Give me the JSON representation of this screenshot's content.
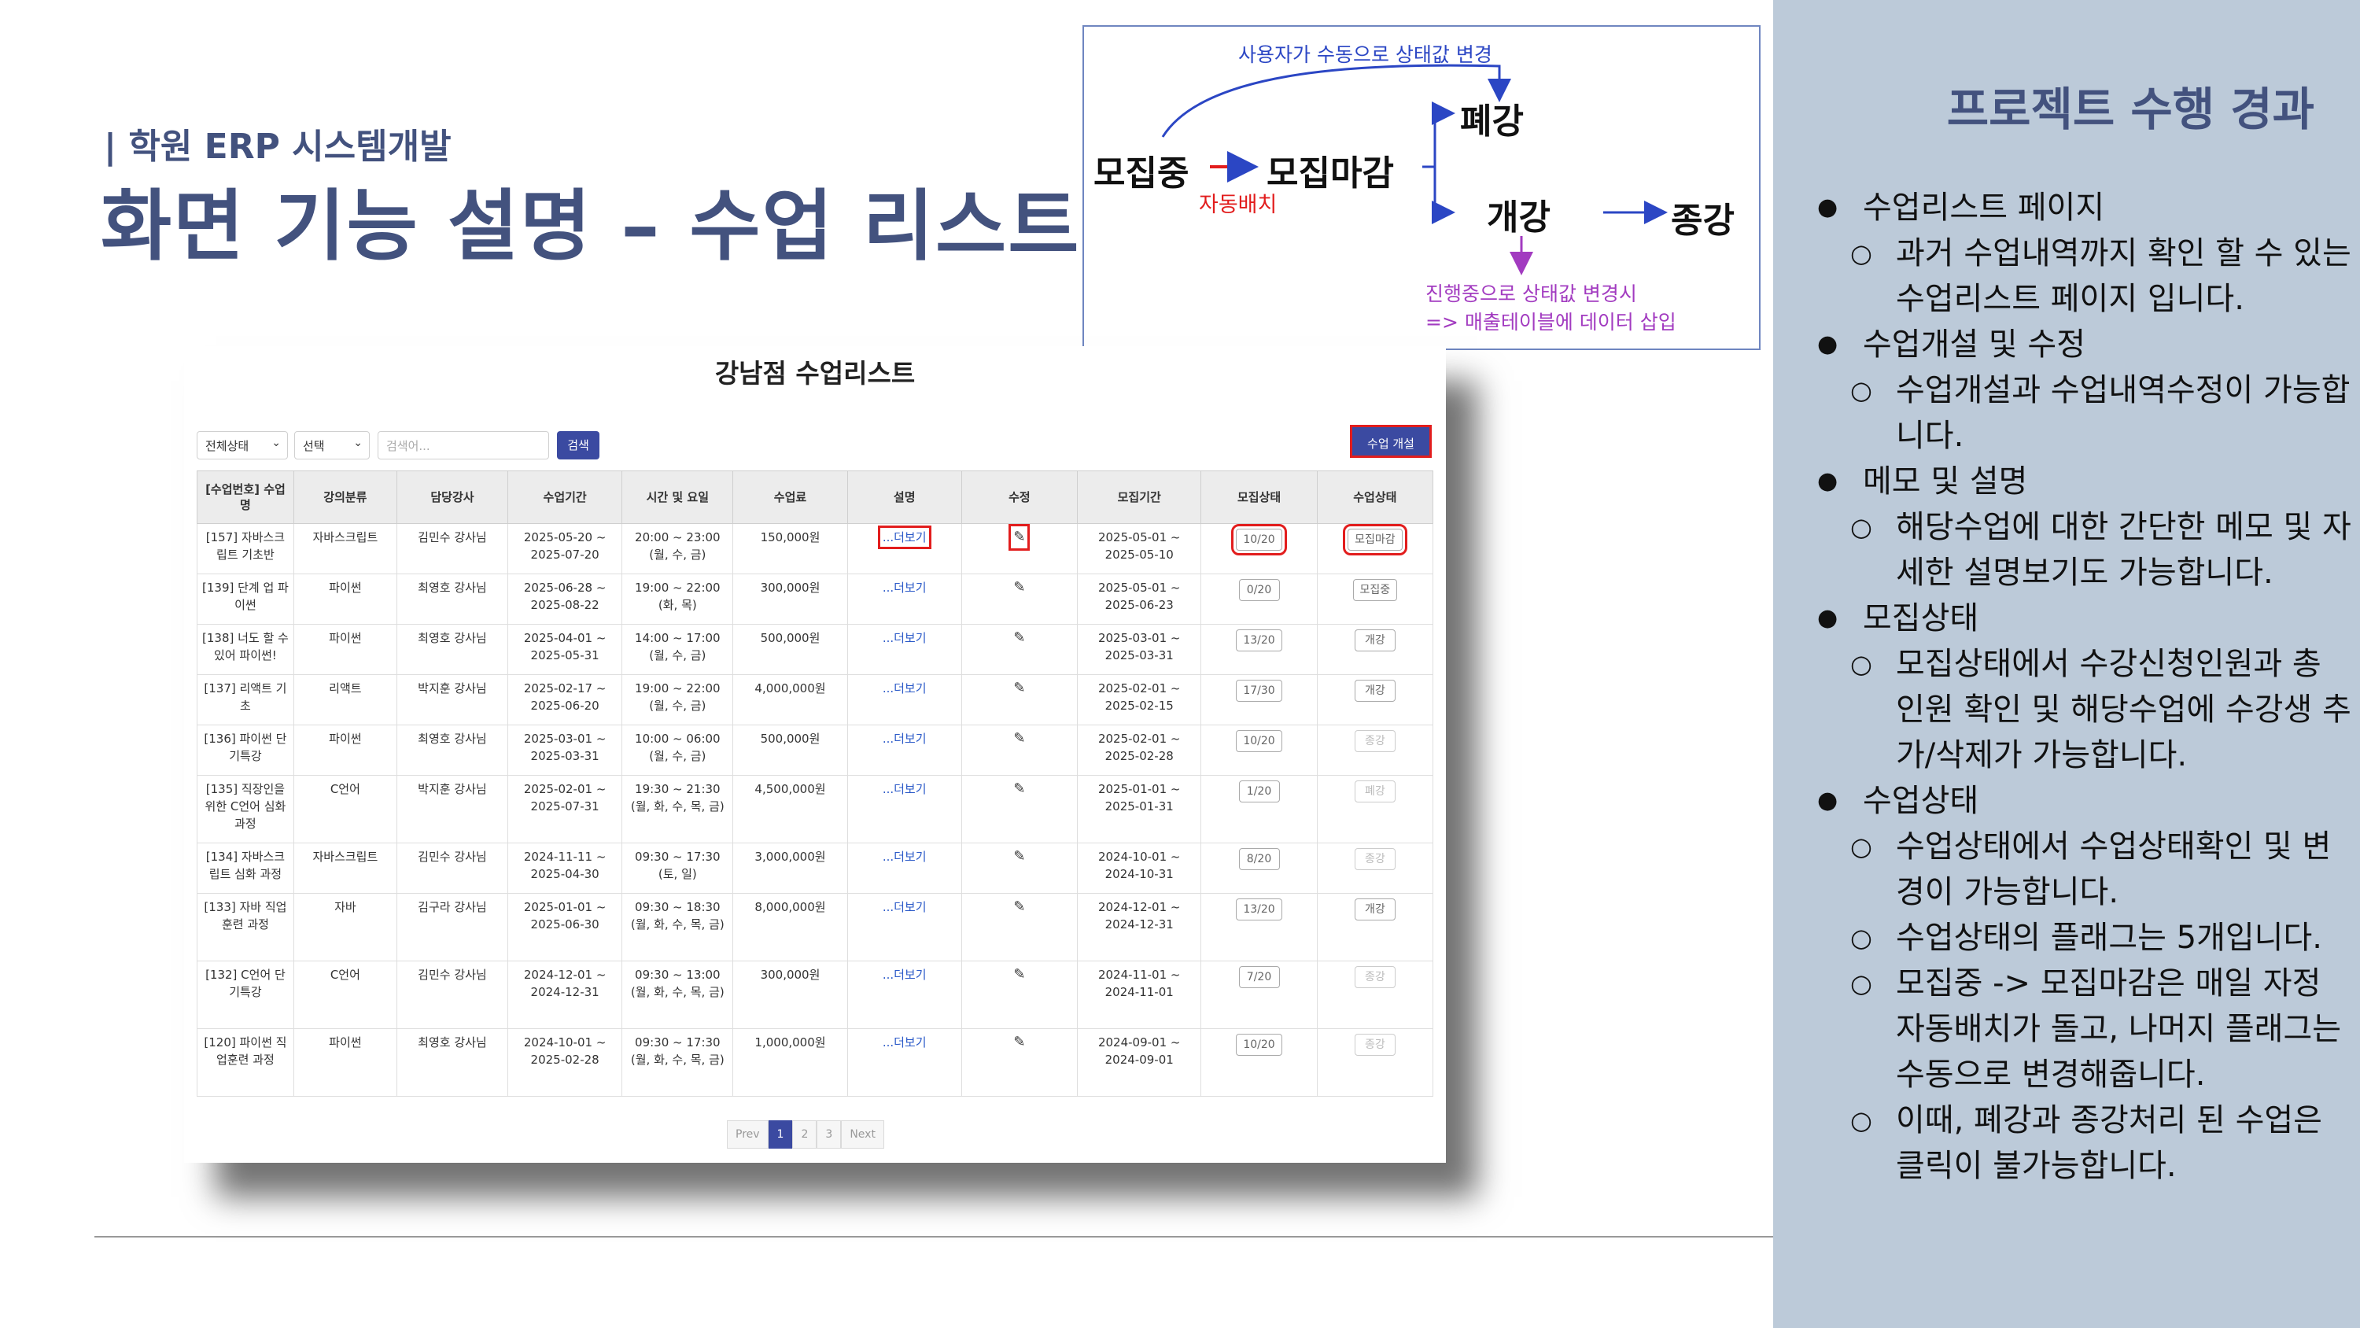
{
  "slide": {
    "subtitle": "| 학원 ERP 시스템개발",
    "title": "화면 기능 설명 – 수업 리스트"
  },
  "diagram": {
    "top_note": "사용자가 수동으로 상태값 변경",
    "node_recruiting": "모집중",
    "node_closed": "모집마감",
    "auto_label": "자동배치",
    "node_cancelled": "폐강",
    "node_opened": "개강",
    "node_ended": "종강",
    "bottom_note_1": "진행중으로 상태값 변경시",
    "bottom_note_2": "=> 매출테이블에 데이터 삽입"
  },
  "screenshot": {
    "title": "강남점 수업리스트",
    "filters": {
      "status": "전체상태",
      "select": "선택",
      "search_placeholder": "검색어...",
      "search_button": "검색",
      "open_button": "수업 개설"
    },
    "columns": [
      "[수업번호] 수업명",
      "강의분류",
      "담당강사",
      "수업기간",
      "시간 및 요일",
      "수업료",
      "설명",
      "수정",
      "모집기간",
      "모집상태",
      "수업상태"
    ],
    "rows": [
      {
        "name": "[157] 자바스크립트 기초반",
        "category": "자바스크립트",
        "teacher": "김민수 강사님",
        "period": "2025-05-20 ~ 2025-07-20",
        "time": "20:00 ~ 23:00 (월, 수, 금)",
        "fee": "150,000원",
        "desc": "...더보기",
        "edit": "✎",
        "recruit_period": "2025-05-01 ~ 2025-05-10",
        "recruit_status": "10/20",
        "class_status": "모집마감"
      },
      {
        "name": "[139] 단계 업 파이썬",
        "category": "파이썬",
        "teacher": "최영호 강사님",
        "period": "2025-06-28 ~ 2025-08-22",
        "time": "19:00 ~ 22:00 (화, 목)",
        "fee": "300,000원",
        "desc": "...더보기",
        "edit": "✎",
        "recruit_period": "2025-05-01 ~ 2025-06-23",
        "recruit_status": "0/20",
        "class_status": "모집중"
      },
      {
        "name": "[138] 너도 할 수 있어 파이썬!",
        "category": "파이썬",
        "teacher": "최영호 강사님",
        "period": "2025-04-01 ~ 2025-05-31",
        "time": "14:00 ~ 17:00 (월, 수, 금)",
        "fee": "500,000원",
        "desc": "...더보기",
        "edit": "✎",
        "recruit_period": "2025-03-01 ~ 2025-03-31",
        "recruit_status": "13/20",
        "class_status": "개강"
      },
      {
        "name": "[137] 리액트 기초",
        "category": "리액트",
        "teacher": "박지훈 강사님",
        "period": "2025-02-17 ~ 2025-06-20",
        "time": "19:00 ~ 22:00 (월, 수, 금)",
        "fee": "4,000,000원",
        "desc": "...더보기",
        "edit": "✎",
        "recruit_period": "2025-02-01 ~ 2025-02-15",
        "recruit_status": "17/30",
        "class_status": "개강"
      },
      {
        "name": "[136] 파이썬 단기특강",
        "category": "파이썬",
        "teacher": "최영호 강사님",
        "period": "2025-03-01 ~ 2025-03-31",
        "time": "10:00 ~ 06:00 (월, 수, 금)",
        "fee": "500,000원",
        "desc": "...더보기",
        "edit": "✎",
        "recruit_period": "2025-02-01 ~ 2025-02-28",
        "recruit_status": "10/20",
        "class_status": "종강"
      },
      {
        "name": "[135] 직장인을 위한 C언어 심화 과정",
        "category": "C언어",
        "teacher": "박지훈 강사님",
        "period": "2025-02-01 ~ 2025-07-31",
        "time": "19:30 ~ 21:30 (월, 화, 수, 목, 금)",
        "fee": "4,500,000원",
        "desc": "...더보기",
        "edit": "✎",
        "recruit_period": "2025-01-01 ~ 2025-01-31",
        "recruit_status": "1/20",
        "class_status": "폐강"
      },
      {
        "name": "[134] 자바스크립트 심화 과정",
        "category": "자바스크립트",
        "teacher": "김민수 강사님",
        "period": "2024-11-11 ~ 2025-04-30",
        "time": "09:30 ~ 17:30 (토, 일)",
        "fee": "3,000,000원",
        "desc": "...더보기",
        "edit": "✎",
        "recruit_period": "2024-10-01 ~ 2024-10-31",
        "recruit_status": "8/20",
        "class_status": "종강"
      },
      {
        "name": "[133] 자바 직업훈련 과정",
        "category": "자바",
        "teacher": "김구라 강사님",
        "period": "2025-01-01 ~ 2025-06-30",
        "time": "09:30 ~ 18:30 (월, 화, 수, 목, 금)",
        "fee": "8,000,000원",
        "desc": "...더보기",
        "edit": "✎",
        "recruit_period": "2024-12-01 ~ 2024-12-31",
        "recruit_status": "13/20",
        "class_status": "개강"
      },
      {
        "name": "[132] C언어 단기특강",
        "category": "C언어",
        "teacher": "김민수 강사님",
        "period": "2024-12-01 ~ 2024-12-31",
        "time": "09:30 ~ 13:00 (월, 화, 수, 목, 금)",
        "fee": "300,000원",
        "desc": "...더보기",
        "edit": "✎",
        "recruit_period": "2024-11-01 ~ 2024-11-01",
        "recruit_status": "7/20",
        "class_status": "종강"
      },
      {
        "name": "[120] 파이썬 직업훈련 과정",
        "category": "파이썬",
        "teacher": "최영호 강사님",
        "period": "2024-10-01 ~ 2025-02-28",
        "time": "09:30 ~ 17:30 (월, 화, 수, 목, 금)",
        "fee": "1,000,000원",
        "desc": "...더보기",
        "edit": "✎",
        "recruit_period": "2024-09-01 ~ 2024-09-01",
        "recruit_status": "10/20",
        "class_status": "종강"
      }
    ],
    "pagination": {
      "prev": "Prev",
      "pages": [
        "1",
        "2",
        "3"
      ],
      "active": "1",
      "next": "Next"
    }
  },
  "panel": {
    "title": "프로젝트 수행 경과",
    "items": [
      {
        "text": "수업리스트 페이지",
        "subs": [
          "과거 수업내역까지 확인 할 수 있는 수업리스트 페이지 입니다."
        ]
      },
      {
        "text": "수업개설 및 수정",
        "subs": [
          "수업개설과 수업내역수정이 가능합니다."
        ]
      },
      {
        "text": "메모 및 설명",
        "subs": [
          "해당수업에 대한 간단한 메모 및 자세한 설명보기도 가능합니다."
        ]
      },
      {
        "text": "모집상태",
        "subs": [
          "모집상태에서 수강신청인원과 총 인원 확인 및 해당수업에 수강생 추가/삭제가 가능합니다."
        ]
      },
      {
        "text": "수업상태",
        "subs": [
          "수업상태에서 수업상태확인 및 변경이 가능합니다.",
          "수업상태의 플래그는 5개입니다.",
          "모집중 -> 모집마감은 매일 자정 자동배치가 돌고, 나머지 플래그는 수동으로 변경해줍니다.",
          "이때, 폐강과 종강처리 된 수업은 클릭이 불가능합니다."
        ]
      }
    ]
  },
  "colors": {
    "title": "#43527e",
    "panel_bg": "#bccad9",
    "button": "#3b4aa1",
    "highlight": "#e21d1d",
    "diagram_arrow": "#2b46c4",
    "diagram_note": "#a23bc0"
  }
}
